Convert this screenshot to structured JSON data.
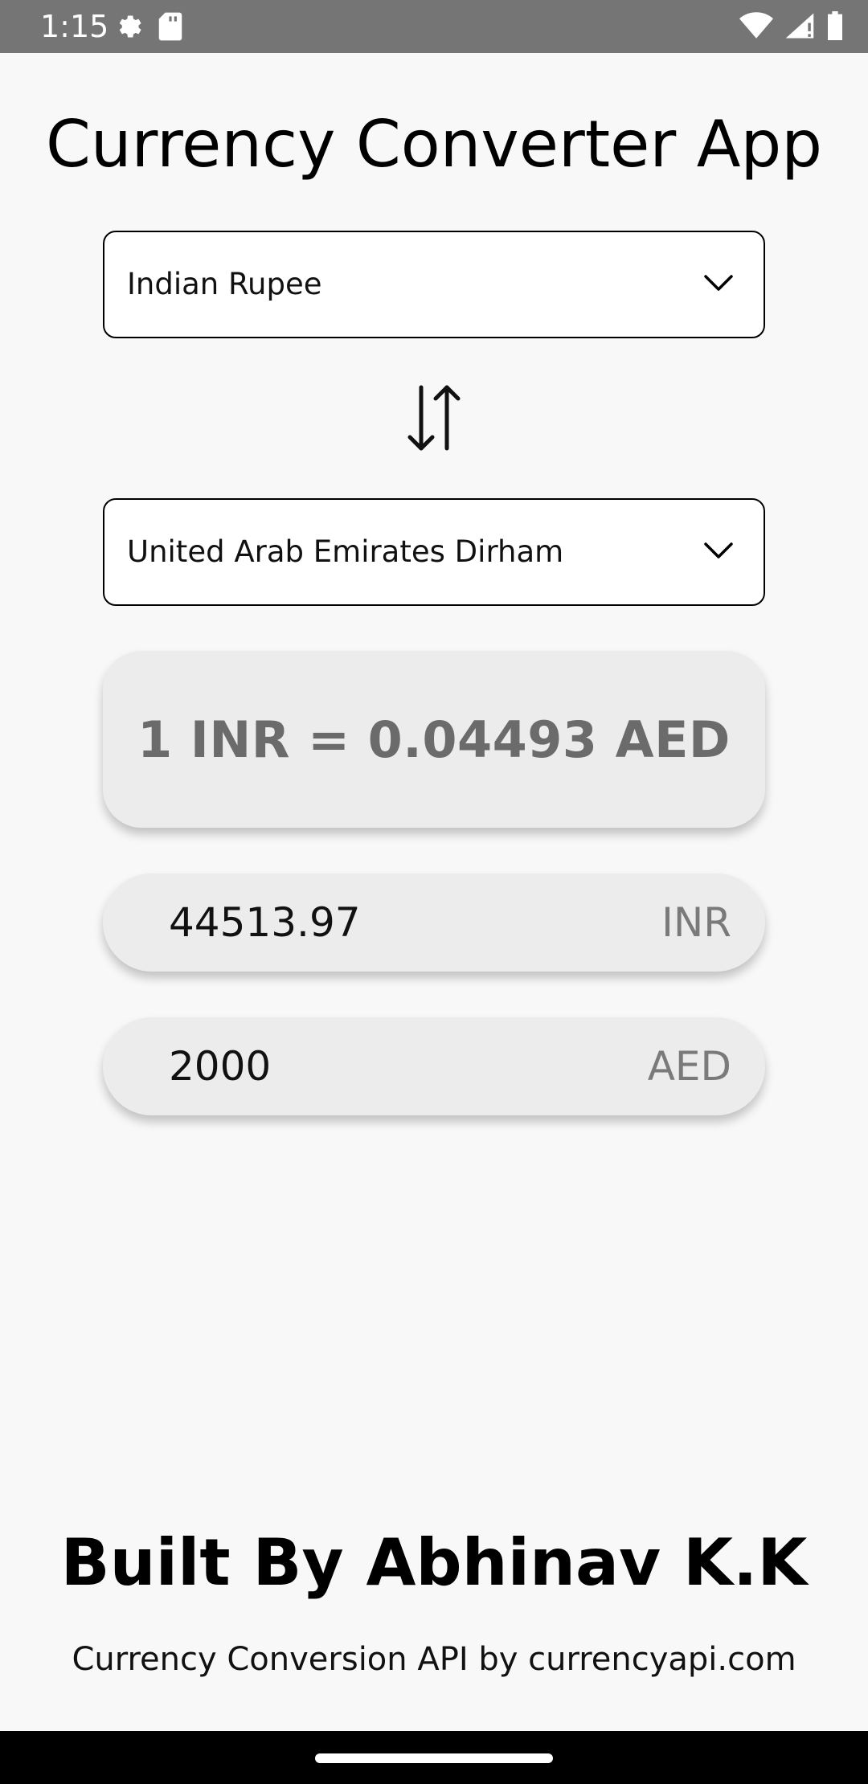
{
  "status_bar": {
    "time": "1:15",
    "left_icons": [
      "settings-icon",
      "sd-card-icon"
    ],
    "right_icons": [
      "wifi-icon",
      "signal-icon",
      "battery-icon"
    ]
  },
  "app": {
    "title": "Currency Converter App"
  },
  "converter": {
    "from_currency": "Indian Rupee",
    "to_currency": "United Arab Emirates Dirham",
    "swap_icon": "swap-vertical-icon",
    "rate_text": "1 INR = 0.04493 AED",
    "from_amount": "44513.97",
    "from_code": "INR",
    "to_amount": "2000",
    "to_code": "AED"
  },
  "footer": {
    "credit": "Built By Abhinav K.K",
    "api_note": "Currency Conversion API by currencyapi.com"
  },
  "colors": {
    "status_bar": "#757575",
    "background": "#f8f8f8",
    "card": "#ececec",
    "rate_text": "#6b6b6b",
    "nav_bar": "#000000"
  }
}
